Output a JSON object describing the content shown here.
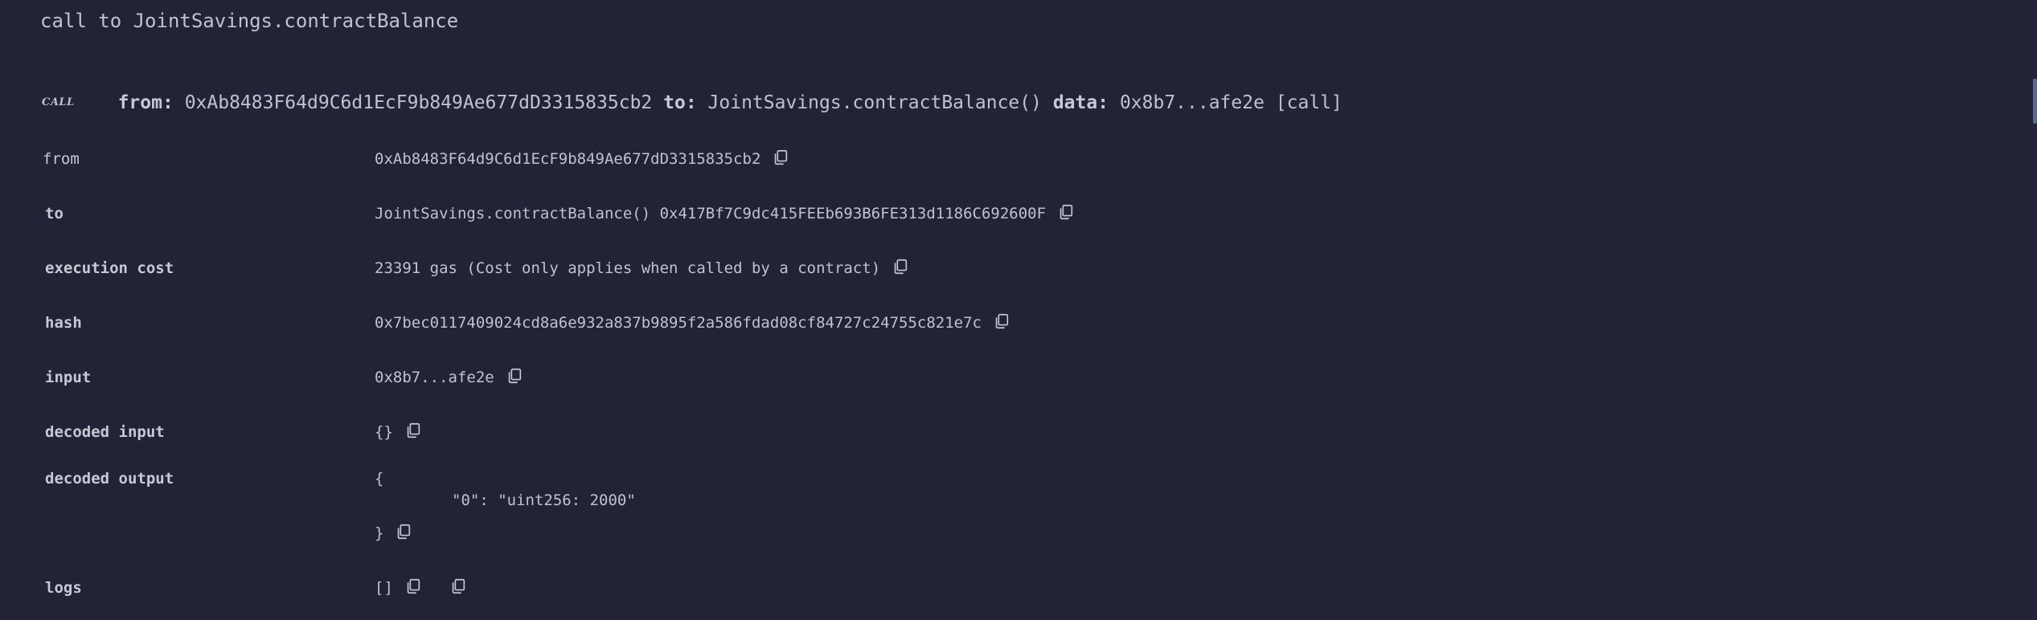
{
  "header": {
    "title": "call to JointSavings.contractBalance"
  },
  "callbar": {
    "tag": "CALL",
    "from_label": "from:",
    "from_value": "0xAb8483F64d9C6d1EcF9b849Ae677dD3315835cb2",
    "to_label": "to:",
    "to_value": "JointSavings.contractBalance()",
    "data_label": "data:",
    "data_value": "0x8b7...afe2e",
    "kind": "[call]"
  },
  "rows": {
    "from": {
      "label": "from",
      "value": "0xAb8483F64d9C6d1EcF9b849Ae677dD3315835cb2"
    },
    "to": {
      "label": "to",
      "value": "JointSavings.contractBalance() 0x417Bf7C9dc415FEEb693B6FE313d1186C692600F"
    },
    "execution_cost": {
      "label": "execution cost",
      "value": "23391 gas (Cost only applies when called by a contract)"
    },
    "hash": {
      "label": "hash",
      "value": "0x7bec0117409024cd8a6e932a837b9895f2a586fdad08cf84727c24755c821e7c"
    },
    "input": {
      "label": "input",
      "value": "0x8b7...afe2e"
    },
    "decoded_input": {
      "label": "decoded input",
      "value": "{}"
    },
    "decoded_output": {
      "label": "decoded output",
      "open": "{",
      "line": "\"0\": \"uint256: 2000\"",
      "close": "}"
    },
    "logs": {
      "label": "logs",
      "value": "[]"
    }
  },
  "icons": {
    "copy": "copy-icon"
  }
}
